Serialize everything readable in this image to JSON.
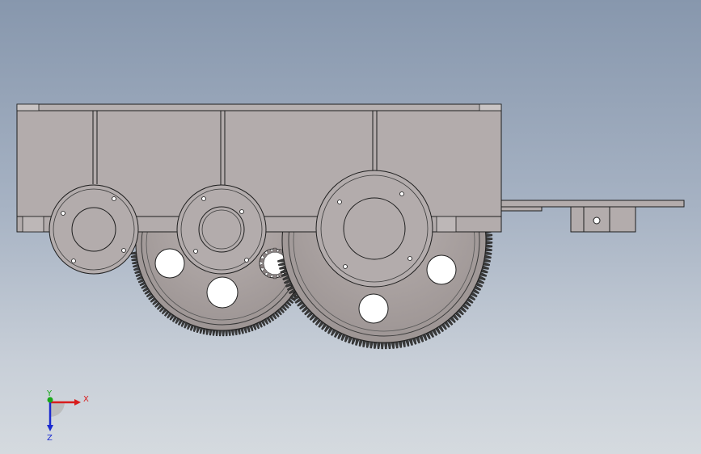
{
  "viewport": {
    "background_top": "#8797ad",
    "background_bottom": "#d5dadf"
  },
  "model": {
    "part_fill": "#b3acac",
    "part_stroke": "#1e1e1e",
    "gear_fill": "#a9a1a0",
    "tooth_fill": "#3a3a3a"
  },
  "triad": {
    "x_label": "X",
    "y_label": "Y",
    "z_label": "Z",
    "x_color": "#d81c1c",
    "y_color": "#18a818",
    "z_color": "#1a2ad0"
  }
}
